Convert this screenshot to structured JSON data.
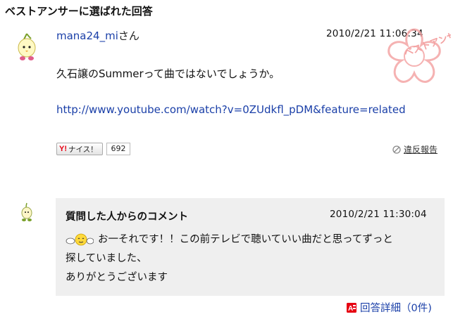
{
  "section": {
    "title": "ベストアンサーに選ばれた回答"
  },
  "answer": {
    "username": "mana24_mi",
    "honorific": "さん",
    "datetime": "2010/2/21  11:06:34",
    "stamp_text": "ベストアンサー",
    "text": "久石譲のSummerって曲ではないでしょうか。",
    "link": "http://www.youtube.com/watch?v=0ZUdkfl_pDM&feature=related",
    "nice": {
      "brand": "Y!",
      "label": "ナイス！",
      "count": "692"
    },
    "report_label": "違反報告"
  },
  "comment": {
    "title": "質問した人からのコメント",
    "datetime": "2010/2/21 11:30:04",
    "line1": "お一それです！！この前テレビで聴いていい曲だと思ってずっと",
    "line2": "探していました、",
    "line3": "ありがとうございます"
  },
  "detail": {
    "label": "回答詳細（0件)"
  },
  "colors": {
    "link": "#1a3fa8",
    "comment_bg": "#efefef",
    "stamp": "#f3a0a0",
    "accent_red": "#e60012"
  }
}
